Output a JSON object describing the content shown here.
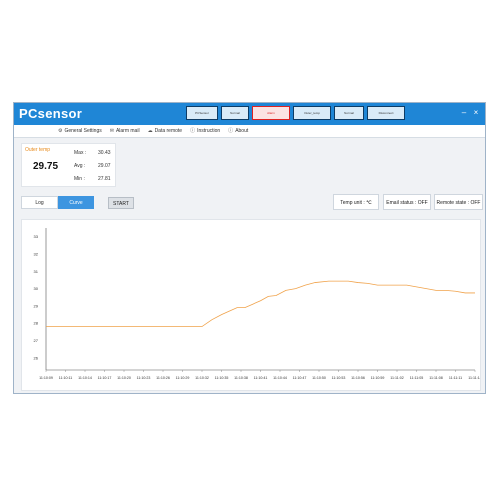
{
  "app": {
    "logo": "PCsensor",
    "devices": [
      "PCSensor",
      "Normal",
      "Alarm",
      "Outer_temp",
      "Normal",
      "Disconnect"
    ],
    "menu": [
      "General Settings",
      "Alarm mail",
      "Data remote",
      "Instruction",
      "About"
    ]
  },
  "stats": {
    "label": "Outer temp",
    "current": "29.75",
    "max_label": "Max :",
    "max": "30.43",
    "avg_label": "Avg :",
    "avg": "29.07",
    "min_label": "Min :",
    "min": "27.81"
  },
  "controls": {
    "tab_log": "Log",
    "tab_curve": "Curve",
    "start": "START",
    "temp_unit": "Temp unit : ℃",
    "email_status": "Email status : OFF",
    "remote_state": "Remote state : OFF"
  },
  "legend": {
    "series": "Outer Temp",
    "checked": true,
    "three_d": "3D"
  },
  "colors": {
    "title_bar": "#1f86d6",
    "curve_tab": "#3d95e0",
    "series": "#f0a24a",
    "alarm": "#dd2222"
  },
  "chart_data": {
    "type": "line",
    "y_ticks": [
      "33",
      "32",
      "31",
      "30",
      "29",
      "28",
      "27",
      "26"
    ],
    "ylim": [
      25.3,
      33.5
    ],
    "x_ticks": [
      "11:10:09",
      "11:10:11",
      "11:10:14",
      "11:10:17",
      "11:10:20",
      "11:10:23",
      "11:10:26",
      "11:10:29",
      "11:10:32",
      "11:10:35",
      "11:10:38",
      "11:10:41",
      "11:10:44",
      "11:10:47",
      "11:10:50",
      "11:10:53",
      "11:10:56",
      "11:10:59",
      "11:11:02",
      "11:11:05",
      "11:11:08",
      "11:11:11",
      "11:11:14"
    ],
    "series": [
      {
        "name": "Outer Temp",
        "x": [
          0,
          1,
          2,
          3,
          4,
          5,
          6,
          7,
          8,
          8.5,
          9,
          9.4,
          9.8,
          10.2,
          10.6,
          11,
          11.4,
          11.8,
          12.3,
          12.8,
          13.3,
          13.8,
          14.5,
          15.5,
          16,
          16.5,
          17,
          17.5,
          18,
          18.5,
          19,
          19.5,
          20,
          20.5,
          21,
          21.5,
          22
        ],
        "y": [
          27.81,
          27.81,
          27.81,
          27.81,
          27.81,
          27.81,
          27.81,
          27.81,
          27.81,
          28.2,
          28.5,
          28.7,
          28.9,
          28.9,
          29.1,
          29.3,
          29.55,
          29.6,
          29.9,
          30.0,
          30.2,
          30.35,
          30.43,
          30.43,
          30.35,
          30.3,
          30.2,
          30.2,
          30.2,
          30.2,
          30.1,
          30.0,
          29.9,
          29.9,
          29.85,
          29.75,
          29.75
        ]
      }
    ]
  }
}
